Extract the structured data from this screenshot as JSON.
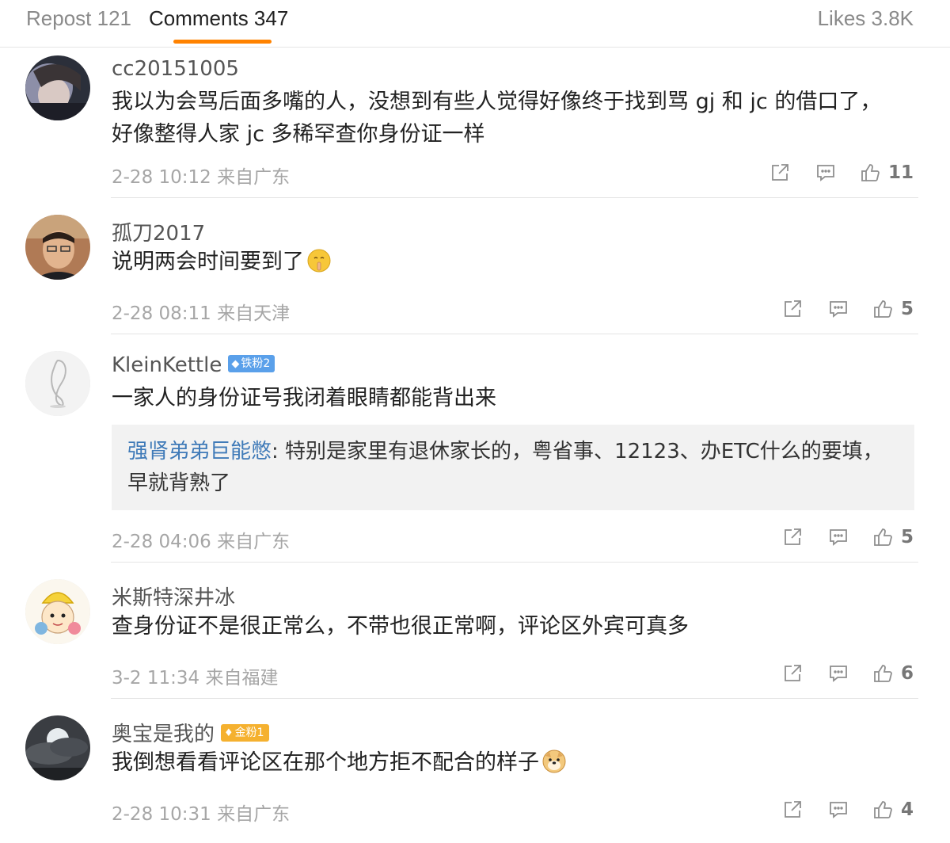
{
  "tabs": {
    "repost": "Repost 121",
    "comments": "Comments 347",
    "likes": "Likes 3.8K"
  },
  "colors": {
    "accent": "#ff8200",
    "link": "#3f7ab8",
    "meta": "#a6a6a6"
  },
  "icons": {
    "share": "share-icon",
    "reply": "comment-icon",
    "like": "thumbs-up-icon"
  },
  "comments": [
    {
      "username": "cc20151005",
      "text": "我以为会骂后面多嘴的人，没想到有些人觉得好像终于找到骂 gj 和 jc 的借口了，好像整得人家 jc 多稀罕查你身份证一样",
      "time": "2-28 10:12 来自广东",
      "likes": "11"
    },
    {
      "username": "孤刀2017",
      "text": "说明两会时间要到了",
      "emoji": "shush-emoji",
      "time": "2-28 08:11 来自天津",
      "likes": "5"
    },
    {
      "username": "KleinKettle",
      "badge": "铁粉2",
      "text": "一家人的身份证号我闭着眼睛都能背出来",
      "reply": {
        "name": "强肾弟弟巨能憋",
        "separator": ": ",
        "text": "特别是家里有退休家长的，粤省事、12123、办ETC什么的要填，早就背熟了"
      },
      "time": "2-28 04:06 来自广东",
      "likes": "5"
    },
    {
      "username": "米斯特深井冰",
      "text": "查身份证不是很正常么，不带也很正常啊，评论区外宾可真多",
      "time": "3-2 11:34 来自福建",
      "likes": "6"
    },
    {
      "username": "奥宝是我的",
      "badge": "金粉1",
      "text": "我倒想看看评论区在那个地方拒不配合的样子",
      "emoji": "doge-emoji",
      "time": "2-28 10:31 来自广东",
      "likes": "4"
    }
  ]
}
